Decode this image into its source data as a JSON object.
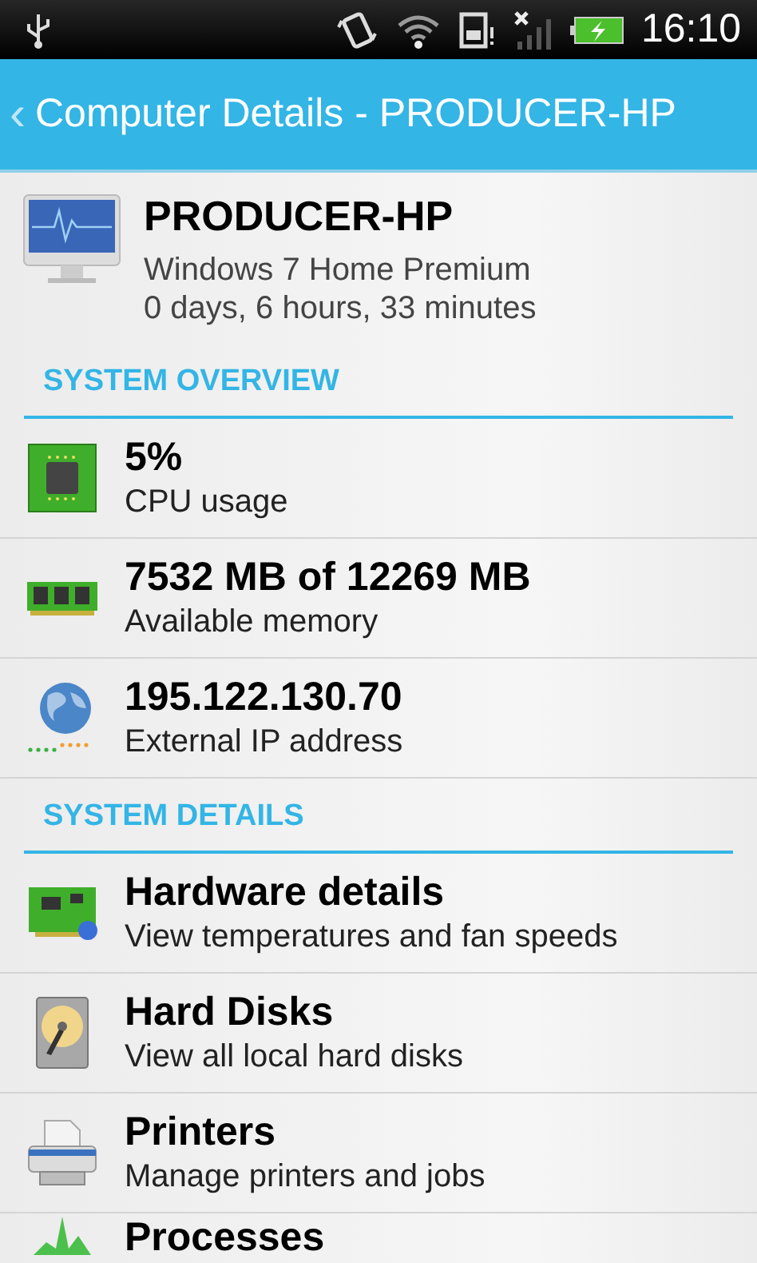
{
  "status_bar": {
    "time": "16:10"
  },
  "app_bar": {
    "back": "‹",
    "title": "Computer Details - PRODUCER-HP"
  },
  "computer": {
    "name": "PRODUCER-HP",
    "os": "Windows 7 Home Premium",
    "uptime": "0 days, 6 hours, 33 minutes"
  },
  "sections": [
    {
      "title": "SYSTEM OVERVIEW",
      "items": [
        {
          "kind": "cpu",
          "title": "5%",
          "subtitle": "CPU usage"
        },
        {
          "kind": "memory",
          "title": "7532 MB of 12269 MB",
          "subtitle": "Available memory"
        },
        {
          "kind": "globe",
          "title": "195.122.130.70",
          "subtitle": "External IP address"
        }
      ]
    },
    {
      "title": "SYSTEM DETAILS",
      "items": [
        {
          "kind": "card",
          "title": "Hardware details",
          "subtitle": "View temperatures and fan speeds"
        },
        {
          "kind": "disk",
          "title": "Hard Disks",
          "subtitle": "View all local hard disks"
        },
        {
          "kind": "printer",
          "title": "Printers",
          "subtitle": "Manage printers and jobs"
        },
        {
          "kind": "chart",
          "title": "Processes"
        }
      ]
    }
  ]
}
